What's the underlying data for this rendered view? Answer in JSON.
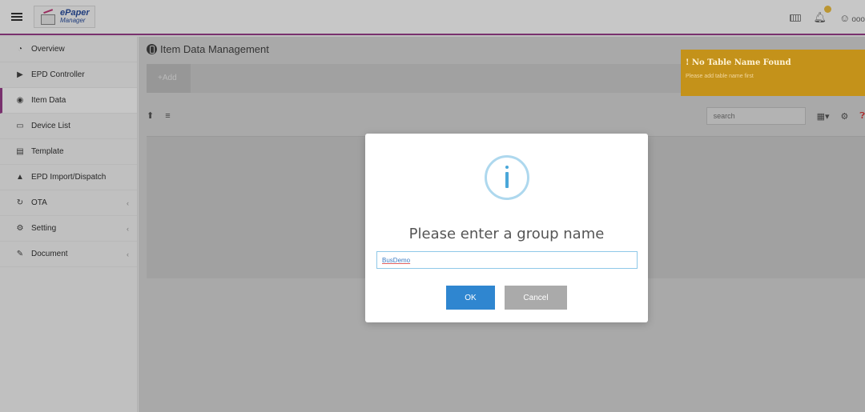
{
  "header": {
    "logo_line1": "ePaper",
    "logo_line2": "Manager",
    "user_label": "ooo"
  },
  "sidebar": {
    "items": [
      {
        "label": "Overview",
        "icon": "dashboard-icon",
        "active": false,
        "has_submenu": false
      },
      {
        "label": "EPD Controller",
        "icon": "tag-icon",
        "active": false,
        "has_submenu": false
      },
      {
        "label": "Item Data",
        "icon": "database-icon",
        "active": true,
        "has_submenu": false
      },
      {
        "label": "Device List",
        "icon": "monitor-icon",
        "active": false,
        "has_submenu": false
      },
      {
        "label": "Template",
        "icon": "template-icon",
        "active": false,
        "has_submenu": false
      },
      {
        "label": "EPD Import/Dispatch",
        "icon": "upload-icon",
        "active": false,
        "has_submenu": false
      },
      {
        "label": "OTA",
        "icon": "refresh-icon",
        "active": false,
        "has_submenu": true
      },
      {
        "label": "Setting",
        "icon": "settings-icon",
        "active": false,
        "has_submenu": true
      },
      {
        "label": "Document",
        "icon": "document-icon",
        "active": false,
        "has_submenu": true
      }
    ]
  },
  "main": {
    "title": "Item Data Management",
    "add_tab": "+Add",
    "search_placeholder": "search"
  },
  "toast": {
    "title": "! No Table Name Found",
    "message": "Please add table name first"
  },
  "modal": {
    "title": "Please enter a group name",
    "input_value": "BusDemo",
    "ok_label": "OK",
    "cancel_label": "Cancel"
  },
  "colors": {
    "accent": "#9b3f8e",
    "ok_button": "#2f86d0",
    "cancel_button": "#aaaaaa",
    "toast": "#c4921a"
  }
}
